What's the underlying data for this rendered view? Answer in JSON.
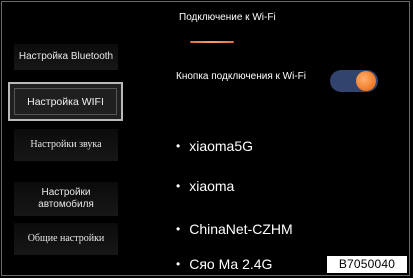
{
  "header": {
    "title": "Подключение к Wi-Fi"
  },
  "sidebar": {
    "items": [
      {
        "label": "Настройка Bluetooth"
      },
      {
        "label": "Настройка WIFI"
      },
      {
        "label": "Настройки звука"
      },
      {
        "label": "Настройки автомобиля"
      },
      {
        "label": "Общие настройки"
      }
    ]
  },
  "wifi_toggle": {
    "label": "Кнопка подключения к Wi-Fi",
    "state": "on"
  },
  "networks": [
    {
      "name": "xiaoma5G"
    },
    {
      "name": "xiaoma"
    },
    {
      "name": "ChinaNet-CZHM"
    },
    {
      "name": "Сяо Ма 2.4G"
    }
  ],
  "image_code": "B7050040",
  "colors": {
    "accent": "#f0802e",
    "toggle_track": "#32436e",
    "background": "#000000"
  }
}
